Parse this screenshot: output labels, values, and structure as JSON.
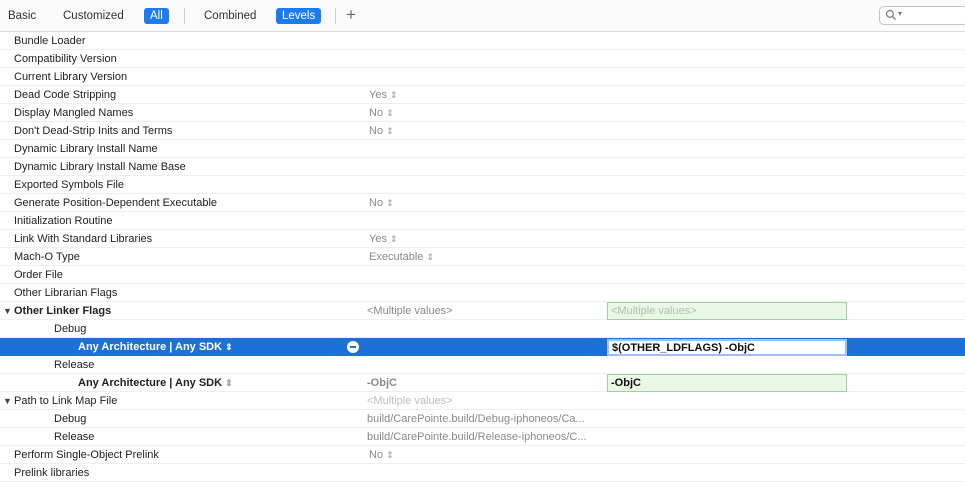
{
  "toolbar": {
    "basic": "Basic",
    "customized": "Customized",
    "all": "All",
    "combined": "Combined",
    "levels": "Levels",
    "add": "+"
  },
  "settings": {
    "bundle_loader": "Bundle Loader",
    "compatibility_version": "Compatibility Version",
    "current_library_version": "Current Library Version",
    "dead_code_stripping": {
      "name": "Dead Code Stripping",
      "value": "Yes"
    },
    "display_mangled_names": {
      "name": "Display Mangled Names",
      "value": "No"
    },
    "dont_dead_strip": {
      "name": "Don't Dead-Strip Inits and Terms",
      "value": "No"
    },
    "dylib_install_name": "Dynamic Library Install Name",
    "dylib_install_name_base": "Dynamic Library Install Name Base",
    "exported_symbols_file": "Exported Symbols File",
    "generate_pde": {
      "name": "Generate Position-Dependent Executable",
      "value": "No"
    },
    "initialization_routine": "Initialization Routine",
    "link_std_libs": {
      "name": "Link With Standard Libraries",
      "value": "Yes"
    },
    "macho_type": {
      "name": "Mach-O Type",
      "value": "Executable"
    },
    "order_file": "Order File",
    "other_librarian_flags": "Other Librarian Flags",
    "other_linker_flags": {
      "name": "Other Linker Flags",
      "resolved": "<Multiple values>",
      "target_value": "<Multiple values>",
      "debug_label": "Debug",
      "debug_arch": "Any Architecture | Any SDK",
      "debug_edit_value": "$(OTHER_LDFLAGS) -ObjC",
      "release_label": "Release",
      "release_arch": "Any Architecture | Any SDK",
      "release_value": "-ObjC",
      "release_target_value": "-ObjC"
    },
    "path_to_link_map": {
      "name": "Path to Link Map File",
      "resolved": "<Multiple values>",
      "debug_label": "Debug",
      "debug_value": "build/CarePointe.build/Debug-iphoneos/Ca...",
      "release_label": "Release",
      "release_value": "build/CarePointe.build/Release-iphoneos/C..."
    },
    "single_object_prelink": {
      "name": "Perform Single-Object Prelink",
      "value": "No"
    },
    "prelink_libraries": "Prelink libraries"
  }
}
